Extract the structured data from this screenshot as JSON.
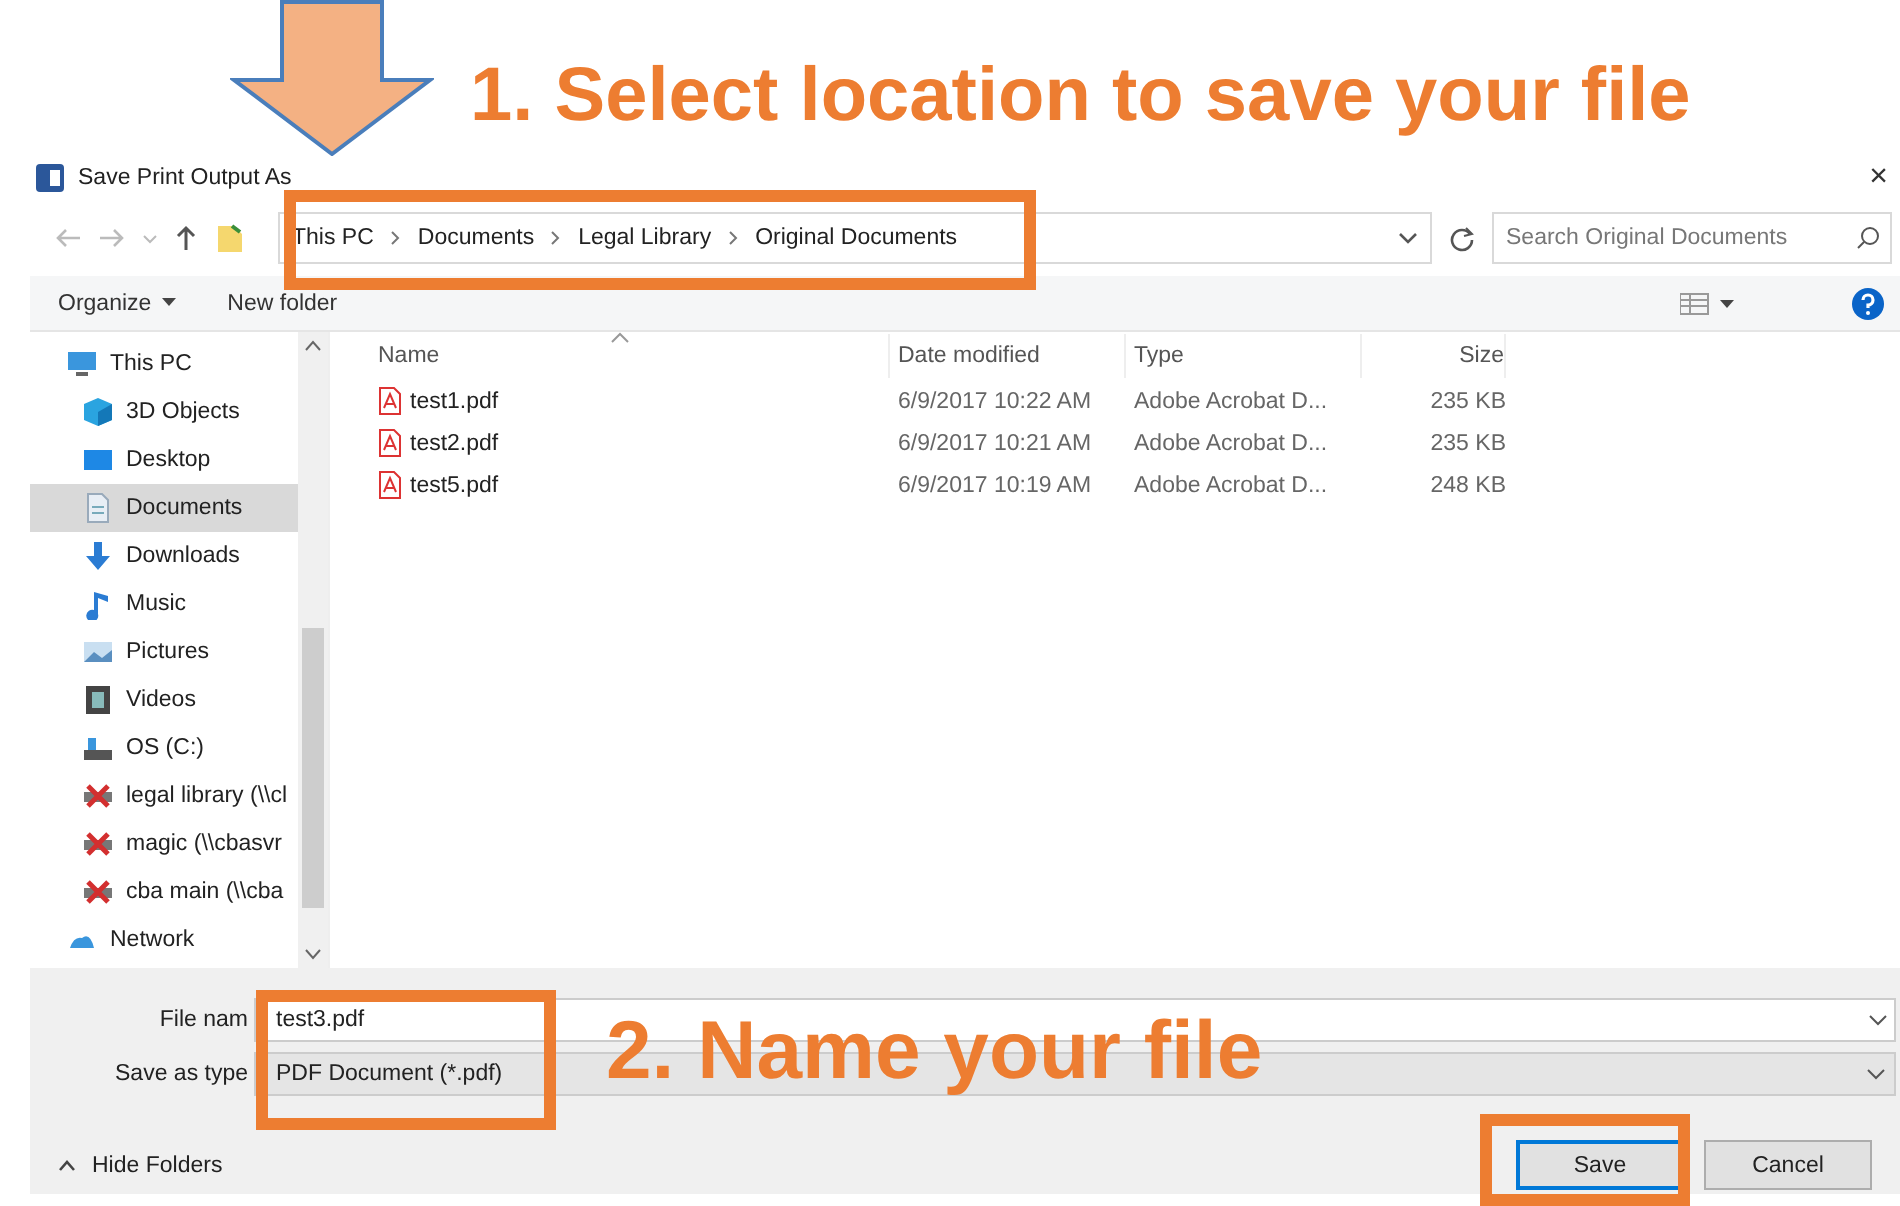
{
  "annotations": [
    {
      "text": "1. Select location to save your file"
    },
    {
      "text": "2. Name your file"
    }
  ],
  "window": {
    "title": "Save Print Output As",
    "close": "×"
  },
  "address": {
    "breadcrumb": [
      "This PC",
      "Documents",
      "Legal Library",
      "Original Documents"
    ]
  },
  "search": {
    "placeholder": "Search Original Documents"
  },
  "toolbar": {
    "organize": "Organize",
    "new_folder": "New folder"
  },
  "nav": {
    "items": [
      {
        "label": "This PC",
        "kind": "pc",
        "selected": false,
        "children": [
          {
            "label": "3D Objects",
            "kind": "objects",
            "selected": false
          },
          {
            "label": "Desktop",
            "kind": "desktop",
            "selected": false
          },
          {
            "label": "Documents",
            "kind": "documents",
            "selected": true
          },
          {
            "label": "Downloads",
            "kind": "downloads",
            "selected": false
          },
          {
            "label": "Music",
            "kind": "music",
            "selected": false
          },
          {
            "label": "Pictures",
            "kind": "pictures",
            "selected": false
          },
          {
            "label": "Videos",
            "kind": "videos",
            "selected": false
          },
          {
            "label": "OS (C:)",
            "kind": "drive",
            "selected": false
          },
          {
            "label": "legal library (\\\\cl",
            "kind": "netdrive",
            "selected": false
          },
          {
            "label": "magic (\\\\cbasvr",
            "kind": "netdrive",
            "selected": false
          },
          {
            "label": "cba main (\\\\cba",
            "kind": "netdrive",
            "selected": false
          }
        ]
      },
      {
        "label": "Network",
        "kind": "network",
        "selected": false
      }
    ]
  },
  "table": {
    "columns": [
      "Name",
      "Date modified",
      "Type",
      "Size"
    ],
    "rows": [
      {
        "name": "test1.pdf",
        "date": "6/9/2017 10:22 AM",
        "type": "Adobe Acrobat D...",
        "size": "235 KB"
      },
      {
        "name": "test2.pdf",
        "date": "6/9/2017 10:21 AM",
        "type": "Adobe Acrobat D...",
        "size": "235 KB"
      },
      {
        "name": "test5.pdf",
        "date": "6/9/2017 10:19 AM",
        "type": "Adobe Acrobat D...",
        "size": "248 KB"
      }
    ]
  },
  "footer": {
    "file_name_label": "File nam",
    "file_name": "test3.pdf",
    "type_label": "Save as type",
    "type_value": "PDF Document (*.pdf)",
    "hide_folders": "Hide Folders",
    "buttons": [
      "Save",
      "Cancel"
    ]
  }
}
